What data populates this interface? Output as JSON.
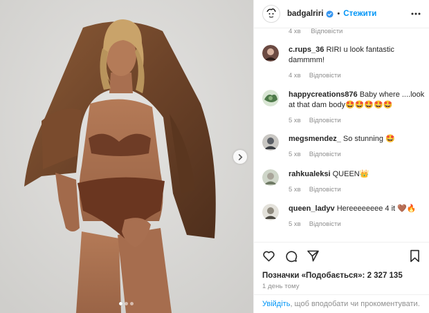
{
  "post": {
    "author": {
      "username": "badgalriri",
      "follow_label": "Стежити",
      "separator": "•"
    },
    "previous_comment_meta": {
      "time": "4 хв",
      "reply_label": "Відповісти"
    },
    "comments": [
      {
        "username": "c.rups_36",
        "text": "RIRI u look fantastic dammmm!",
        "time": "4 хв",
        "reply_label": "Відповісти",
        "avatar_color": "#6b4a42"
      },
      {
        "username": "happycreations876",
        "text": "Baby where ....look at that dam body🤩🤩🤩🤩🤩",
        "time": "5 хв",
        "reply_label": "Відповісти",
        "avatar_color": "#4e7a4a"
      },
      {
        "username": "megsmendez_",
        "text": "So stunning 🤩",
        "time": "5 хв",
        "reply_label": "Відповісти",
        "avatar_color": "#5b5f66"
      },
      {
        "username": "rahkualeksi",
        "text": "QUEEN👑",
        "time": "5 хв",
        "reply_label": "Відповісти",
        "avatar_color": "#a9a59a"
      },
      {
        "username": "queen_ladyv",
        "text": "Hereeeeeeee 4 it 🤎🔥",
        "time": "5 хв",
        "reply_label": "Відповісти",
        "avatar_color": "#8f8a7e"
      }
    ],
    "likes": {
      "label": "Позначки «Подобається»:",
      "count": "2 327 135"
    },
    "date": "1 день тому",
    "login_prompt": {
      "link": "Увійдіть",
      "text": ", щоб вподобати чи прокоментувати."
    },
    "carousel": {
      "dots": 3,
      "active_index": 0
    },
    "icons": {
      "like": "heart-icon",
      "comment": "comment-icon",
      "share": "share-icon",
      "save": "bookmark-icon",
      "more": "more-options-icon",
      "verified": "verified-badge-icon",
      "next": "chevron-right-icon"
    },
    "colors": {
      "accent": "#0095f6",
      "muted": "#8e8e8e",
      "text": "#262626"
    }
  }
}
